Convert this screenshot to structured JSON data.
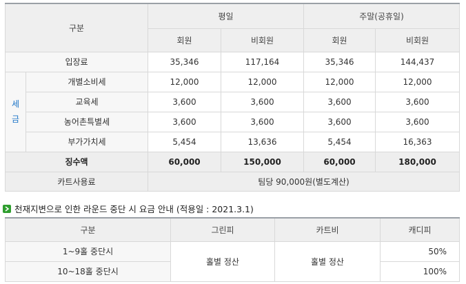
{
  "fee_table": {
    "header": {
      "category": "구분",
      "weekday": "평일",
      "weekend": "주말(공휴일)",
      "member": "회원",
      "non_member": "비회원"
    },
    "tax_group_label": "세\n금",
    "rows": [
      {
        "label": "입장료",
        "values": [
          "35,346",
          "117,164",
          "35,346",
          "144,437"
        ]
      },
      {
        "label": "개별소비세",
        "values": [
          "12,000",
          "12,000",
          "12,000",
          "12,000"
        ]
      },
      {
        "label": "교육세",
        "values": [
          "3,600",
          "3,600",
          "3,600",
          "3,600"
        ]
      },
      {
        "label": "농어촌특별세",
        "values": [
          "3,600",
          "3,600",
          "3,600",
          "3,600"
        ]
      },
      {
        "label": "부가가치세",
        "values": [
          "5,454",
          "13,636",
          "5,454",
          "16,363"
        ]
      },
      {
        "label": "징수액",
        "values": [
          "60,000",
          "150,000",
          "60,000",
          "180,000"
        ]
      }
    ],
    "cart_fee": {
      "label": "카트사용료",
      "value": "팀당 90,000원(별도계산)"
    }
  },
  "notice": {
    "text": "천재지변으로 인한 라운드 중단 시 요금 안내 (적용일 : 2021.3.1)",
    "icon": "arrow-right-icon",
    "icon_color": "#2f9e2f"
  },
  "suspension_table": {
    "header": {
      "category": "구분",
      "green_fee": "그린피",
      "cart_fee": "카트비",
      "caddie_fee": "캐디피"
    },
    "rows": [
      {
        "label": "1~9홀 중단시",
        "caddie": "50%"
      },
      {
        "label": "10~18홀 중단시",
        "caddie": "100%"
      }
    ],
    "green_fee_value": "홀별 정산",
    "cart_fee_value": "홀별 정산"
  }
}
